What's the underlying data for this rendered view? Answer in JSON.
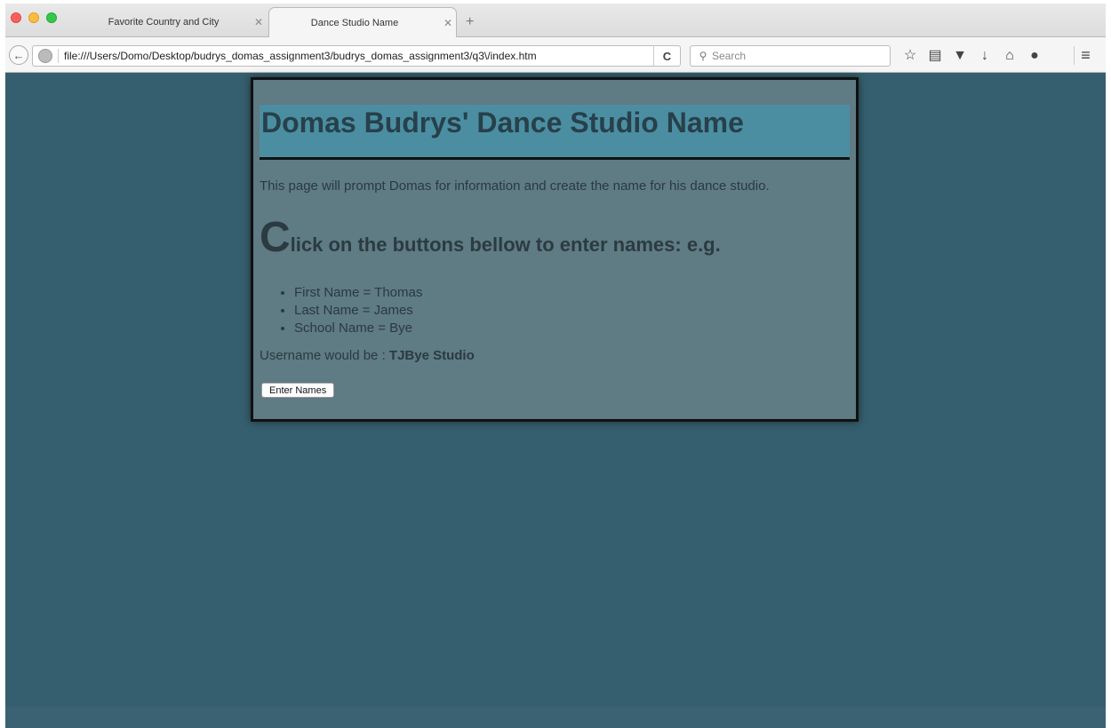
{
  "browser": {
    "tabs": [
      {
        "label": "Favorite Country and City",
        "active": false
      },
      {
        "label": "Dance Studio Name",
        "active": true
      }
    ],
    "new_tab_label": "+",
    "url": "file:///Users/Domo/Desktop/budrys_domas_assignment3/budrys_domas_assignment3/q3\\/index.htm",
    "search_placeholder": "Search",
    "icons": [
      "back-arrow-icon",
      "globe-icon",
      "reload-icon",
      "search-icon",
      "bookmark-star-icon",
      "reading-list-icon",
      "pocket-icon",
      "download-icon",
      "home-icon",
      "chat-icon",
      "menu-icon"
    ]
  },
  "page": {
    "title": "Domas Budrys' Dance Studio Name",
    "intro": "This page will prompt Domas for information and create the name for his dance studio.",
    "instruction_dropcap": "C",
    "instruction_rest": "lick on the buttons bellow to enter names: e.g.",
    "examples": [
      "First Name = Thomas",
      "Last Name = James",
      "School Name = Bye"
    ],
    "result_prefix": "Username would be : ",
    "result_value": "TJBye Studio",
    "button_label": "Enter Names"
  },
  "colors": {
    "page_background": "#355e6e",
    "content_box": "#5f7b84",
    "header_band": "#4b8ea2",
    "text": "#2a3a40"
  }
}
